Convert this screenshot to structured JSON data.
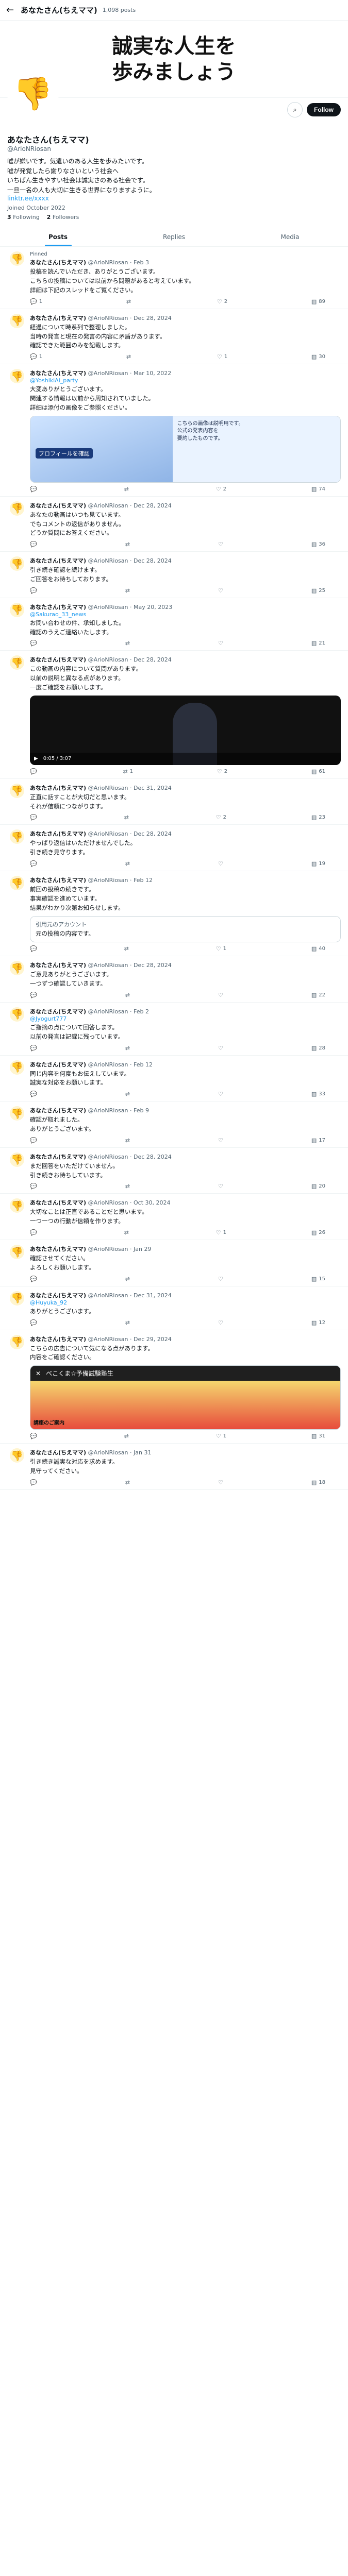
{
  "header": {
    "back_icon": "arrow-left-icon",
    "title": "あなたさん(ちえママ)",
    "post_count": "1,098 posts"
  },
  "banner": {
    "text": "誠実な人生を\n歩みましょう"
  },
  "profile": {
    "avatar_icon": "thumbs-down-icon",
    "name": "あなたさん(ちえママ)",
    "handle": "@ArioNRiosan",
    "bio": "嘘が嫌いです。気遣いのある人生を歩みたいです。\n嘘が発覚したら謝りなさいという社会へ\nいちばん生きやすい社会は誠実さのある社会です。\n一旦一名の人も大切に生きる世界になりますように。",
    "link": "linktr.ee/xxxx",
    "joined": "Joined October 2022",
    "following_count": "3",
    "following_label": "Following",
    "followers_count": "2",
    "followers_label": "Followers",
    "search_icon": "search-icon",
    "follow_label": "Follow"
  },
  "tabs": [
    {
      "label": "Posts"
    },
    {
      "label": "Replies"
    },
    {
      "label": "Media"
    }
  ],
  "pinned_label": "Pinned",
  "show_more": "Show more",
  "tweets": [
    {
      "name": "あなたさん(ちえママ)",
      "handle": "@ArioNRiosan",
      "date": "Feb 3",
      "text": "投稿を読んでいただき、ありがとうございます。\nこちらの投稿については以前から問題があると考えています。\n詳細は下記のスレッドをご覧ください。",
      "replies": "1",
      "reposts": "",
      "likes": "2",
      "views": "89"
    },
    {
      "name": "あなたさん(ちえママ)",
      "handle": "@ArioNRiosan",
      "date": "Dec 28, 2024",
      "text": "経過について時系列で整理しました。\n当時の発言と現在の発言の内容に矛盾があります。\n確認できた範囲のみを記載します。",
      "replies": "1",
      "reposts": "",
      "likes": "1",
      "views": "30"
    },
    {
      "name": "あなたさん(ちえママ)",
      "handle": "@ArioNRiosan",
      "date": "Mar 10, 2022",
      "reply_to": "@YoshikiAi_party",
      "text": "大変ありがとうございます。\n関連する情報は以前から周知されていました。\n詳細は添付の画像をご参照ください。",
      "image_label": "プロフィールを確認",
      "image_text": "こちらの画像は説明用です。\n公式の発表内容を\n要約したものです。",
      "replies": "",
      "reposts": "",
      "likes": "2",
      "views": "74"
    },
    {
      "name": "あなたさん(ちえママ)",
      "handle": "@ArioNRiosan",
      "date": "Dec 28, 2024",
      "text": "あなたの動画はいつも見ています。\nでもコメントの返信がありません。\nどうか質問にお答えください。",
      "replies": "",
      "reposts": "",
      "likes": "",
      "views": "36"
    },
    {
      "name": "あなたさん(ちえママ)",
      "handle": "@ArioNRiosan",
      "date": "Dec 28, 2024",
      "text": "引き続き確認を続けます。\nご回答をお待ちしております。",
      "replies": "",
      "reposts": "",
      "likes": "",
      "views": "25"
    },
    {
      "name": "あなたさん(ちえママ)",
      "handle": "@ArioNRiosan",
      "date": "May 20, 2023",
      "reply_to": "@Sakurao_33_news",
      "text": "お問い合わせの件、承知しました。\n確認のうえご連絡いたします。",
      "replies": "",
      "reposts": "",
      "likes": "",
      "views": "21"
    },
    {
      "name": "あなたさん(ちえママ)",
      "handle": "@ArioNRiosan",
      "date": "Dec 28, 2024",
      "text": "この動画の内容について質問があります。\n以前の説明と異なる点があります。\n一度ご確認をお願いします。",
      "video_time": "0:05 / 3:07",
      "replies": "",
      "reposts": "1",
      "likes": "2",
      "views": "61"
    },
    {
      "name": "あなたさん(ちえママ)",
      "handle": "@ArioNRiosan",
      "date": "Dec 31, 2024",
      "text": "正直に話すことが大切だと思います。\nそれが信頼につながります。",
      "replies": "",
      "reposts": "",
      "likes": "2",
      "views": "23"
    },
    {
      "name": "あなたさん(ちえママ)",
      "handle": "@ArioNRiosan",
      "date": "Dec 28, 2024",
      "text": "やっぱり返信はいただけませんでした。\n引き続き見守ります。",
      "replies": "",
      "reposts": "",
      "likes": "",
      "views": "19"
    },
    {
      "name": "あなたさん(ちえママ)",
      "handle": "@ArioNRiosan",
      "date": "Feb 12",
      "text": "前回の投稿の続きです。\n事実確認を進めています。\n結果がわかり次第お知らせします。",
      "quote_name": "引用元のアカウント",
      "quote_text": "元の投稿の内容です。",
      "replies": "",
      "reposts": "",
      "likes": "1",
      "views": "40"
    },
    {
      "name": "あなたさん(ちえママ)",
      "handle": "@ArioNRiosan",
      "date": "Dec 28, 2024",
      "text": "ご意見ありがとうございます。\n一つずつ確認していきます。",
      "replies": "",
      "reposts": "",
      "likes": "",
      "views": "22"
    },
    {
      "name": "あなたさん(ちえママ)",
      "handle": "@ArioNRiosan",
      "date": "Feb 2",
      "reply_to": "@Jyogurt777",
      "text": "ご指摘の点について回答します。\n以前の発言は記録に残っています。",
      "replies": "",
      "reposts": "",
      "likes": "",
      "views": "28"
    },
    {
      "name": "あなたさん(ちえママ)",
      "handle": "@ArioNRiosan",
      "date": "Feb 12",
      "text": "同じ内容を何度もお伝えしています。\n誠実な対応をお願いします。",
      "replies": "",
      "reposts": "",
      "likes": "",
      "views": "33"
    },
    {
      "name": "あなたさん(ちえママ)",
      "handle": "@ArioNRiosan",
      "date": "Feb 9",
      "text": "確認が取れました。\nありがとうございます。",
      "replies": "",
      "reposts": "",
      "likes": "",
      "views": "17"
    },
    {
      "name": "あなたさん(ちえママ)",
      "handle": "@ArioNRiosan",
      "date": "Dec 28, 2024",
      "text": "まだ回答をいただけていません。\n引き続きお待ちしています。",
      "replies": "",
      "reposts": "",
      "likes": "",
      "views": "20"
    },
    {
      "name": "あなたさん(ちえママ)",
      "handle": "@ArioNRiosan",
      "date": "Oct 30, 2024",
      "text": "大切なことは正直であることだと思います。\n一つ一つの行動が信頼を作ります。",
      "replies": "",
      "reposts": "",
      "likes": "1",
      "views": "26"
    },
    {
      "name": "あなたさん(ちえママ)",
      "handle": "@ArioNRiosan",
      "date": "Jan 29",
      "text": "確認させてください。\nよろしくお願いします。",
      "replies": "",
      "reposts": "",
      "likes": "",
      "views": "15"
    },
    {
      "name": "あなたさん(ちえママ)",
      "handle": "@ArioNRiosan",
      "date": "Dec 31, 2024",
      "reply_to": "@Huyuka_92",
      "text": "ありがとうございます。",
      "replies": "",
      "reposts": "",
      "likes": "",
      "views": "12"
    },
    {
      "name": "あなたさん(ちえママ)",
      "handle": "@ArioNRiosan",
      "date": "Dec 29, 2024",
      "text": "こちらの広告について気になる点があります。\n内容をご確認ください。",
      "ad_title": "べこくま☆予備試験塾生",
      "ad_text": "講座のご案内",
      "replies": "",
      "reposts": "",
      "likes": "1",
      "views": "31"
    },
    {
      "name": "あなたさん(ちえママ)",
      "handle": "@ArioNRiosan",
      "date": "Jan 31",
      "text": "引き続き誠実な対応を求めます。\n見守ってください。",
      "replies": "",
      "reposts": "",
      "likes": "",
      "views": "18"
    }
  ]
}
